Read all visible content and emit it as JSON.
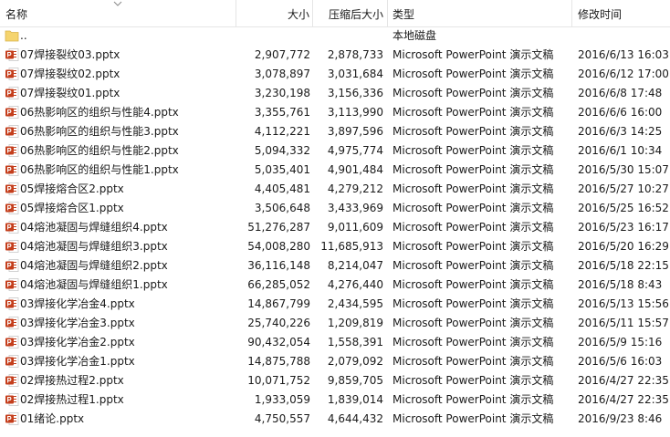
{
  "columns": {
    "name": "名称",
    "size": "大小",
    "compressed": "压缩后大小",
    "type": "类型",
    "modified": "修改时间"
  },
  "icons": {
    "sort": "chevron-down-icon",
    "folder": "folder-icon",
    "file": "powerpoint-file-icon"
  },
  "colors": {
    "powerpoint": "#c43e1c",
    "folder": "#f5d46e"
  },
  "parent_row": {
    "name": "..",
    "type": "本地磁盘"
  },
  "files": [
    {
      "name": "07焊接裂纹03.pptx",
      "size": "2,907,772",
      "compressed": "2,878,733",
      "type": "Microsoft PowerPoint 演示文稿",
      "modified": "2016/6/13 16:03"
    },
    {
      "name": "07焊接裂纹02.pptx",
      "size": "3,078,897",
      "compressed": "3,031,684",
      "type": "Microsoft PowerPoint 演示文稿",
      "modified": "2016/6/12 17:00"
    },
    {
      "name": "07焊接裂纹01.pptx",
      "size": "3,230,198",
      "compressed": "3,156,336",
      "type": "Microsoft PowerPoint 演示文稿",
      "modified": "2016/6/8 17:48"
    },
    {
      "name": "06热影响区的组织与性能4.pptx",
      "size": "3,355,761",
      "compressed": "3,113,990",
      "type": "Microsoft PowerPoint 演示文稿",
      "modified": "2016/6/6 16:00"
    },
    {
      "name": "06热影响区的组织与性能3.pptx",
      "size": "4,112,221",
      "compressed": "3,897,596",
      "type": "Microsoft PowerPoint 演示文稿",
      "modified": "2016/6/3 14:25"
    },
    {
      "name": "06热影响区的组织与性能2.pptx",
      "size": "5,094,332",
      "compressed": "4,975,774",
      "type": "Microsoft PowerPoint 演示文稿",
      "modified": "2016/6/1 10:34"
    },
    {
      "name": "06热影响区的组织与性能1.pptx",
      "size": "5,035,401",
      "compressed": "4,901,484",
      "type": "Microsoft PowerPoint 演示文稿",
      "modified": "2016/5/30 15:07"
    },
    {
      "name": "05焊接熔合区2.pptx",
      "size": "4,405,481",
      "compressed": "4,279,212",
      "type": "Microsoft PowerPoint 演示文稿",
      "modified": "2016/5/27 10:27"
    },
    {
      "name": "05焊接熔合区1.pptx",
      "size": "3,506,648",
      "compressed": "3,433,969",
      "type": "Microsoft PowerPoint 演示文稿",
      "modified": "2016/5/25 16:52"
    },
    {
      "name": "04熔池凝固与焊缝组织4.pptx",
      "size": "51,276,287",
      "compressed": "9,011,609",
      "type": "Microsoft PowerPoint 演示文稿",
      "modified": "2016/5/23 16:17"
    },
    {
      "name": "04熔池凝固与焊缝组织3.pptx",
      "size": "54,008,280",
      "compressed": "11,685,913",
      "type": "Microsoft PowerPoint 演示文稿",
      "modified": "2016/5/20 16:29"
    },
    {
      "name": "04熔池凝固与焊缝组织2.pptx",
      "size": "36,116,148",
      "compressed": "8,214,047",
      "type": "Microsoft PowerPoint 演示文稿",
      "modified": "2016/5/18 22:15"
    },
    {
      "name": "04熔池凝固与焊缝组织1.pptx",
      "size": "66,285,052",
      "compressed": "4,276,440",
      "type": "Microsoft PowerPoint 演示文稿",
      "modified": "2016/5/18 8:43"
    },
    {
      "name": "03焊接化学冶金4.pptx",
      "size": "14,867,799",
      "compressed": "2,434,595",
      "type": "Microsoft PowerPoint 演示文稿",
      "modified": "2016/5/13 15:56"
    },
    {
      "name": "03焊接化学冶金3.pptx",
      "size": "25,740,226",
      "compressed": "1,209,819",
      "type": "Microsoft PowerPoint 演示文稿",
      "modified": "2016/5/11 15:57"
    },
    {
      "name": "03焊接化学冶金2.pptx",
      "size": "90,432,054",
      "compressed": "1,558,391",
      "type": "Microsoft PowerPoint 演示文稿",
      "modified": "2016/5/9 15:16"
    },
    {
      "name": "03焊接化学冶金1.pptx",
      "size": "14,875,788",
      "compressed": "2,079,092",
      "type": "Microsoft PowerPoint 演示文稿",
      "modified": "2016/5/6 16:03"
    },
    {
      "name": "02焊接热过程2.pptx",
      "size": "10,071,752",
      "compressed": "9,859,705",
      "type": "Microsoft PowerPoint 演示文稿",
      "modified": "2016/4/27 22:35"
    },
    {
      "name": "02焊接热过程1.pptx",
      "size": "1,933,059",
      "compressed": "1,839,014",
      "type": "Microsoft PowerPoint 演示文稿",
      "modified": "2016/4/27 22:35"
    },
    {
      "name": "01绪论.pptx",
      "size": "4,750,557",
      "compressed": "4,644,432",
      "type": "Microsoft PowerPoint 演示文稿",
      "modified": "2016/9/23 8:46"
    }
  ]
}
